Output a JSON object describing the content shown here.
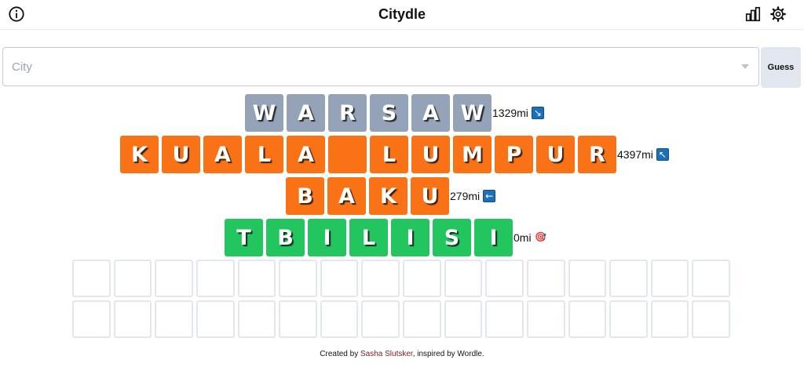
{
  "header": {
    "title": "Citydle",
    "info_icon": "info-circle-icon",
    "stats_icon": "bar-chart-icon",
    "settings_icon": "gear-icon"
  },
  "search": {
    "placeholder": "City",
    "value": "",
    "guess_label": "Guess"
  },
  "guesses": [
    {
      "letters": [
        "W",
        "A",
        "R",
        "S",
        "A",
        "W"
      ],
      "color": "gray",
      "distance": "1329mi",
      "direction_icon": "arrow-down-right-icon",
      "direction_glyph": "↘"
    },
    {
      "letters": [
        "K",
        "U",
        "A",
        "L",
        "A",
        " ",
        "L",
        "U",
        "M",
        "P",
        "U",
        "R"
      ],
      "color": "orange",
      "distance": "4397mi",
      "direction_icon": "arrow-up-left-icon",
      "direction_glyph": "↖"
    },
    {
      "letters": [
        "B",
        "A",
        "K",
        "U"
      ],
      "color": "orange",
      "distance": "279mi",
      "direction_icon": "arrow-left-icon",
      "direction_glyph": "←"
    },
    {
      "letters": [
        "T",
        "B",
        "I",
        "L",
        "I",
        "S",
        "I"
      ],
      "color": "green",
      "distance": "0mi",
      "direction_icon": "target-icon",
      "direction_glyph": "🎯"
    }
  ],
  "tile_colors": {
    "gray": "#94a3b8",
    "orange": "#f97316",
    "green": "#22c55e"
  },
  "footer": {
    "prefix": "Created by ",
    "author": "Sasha Slutsker",
    "middle": ", inspired by ",
    "inspiration": "Wordle",
    "suffix": "."
  }
}
